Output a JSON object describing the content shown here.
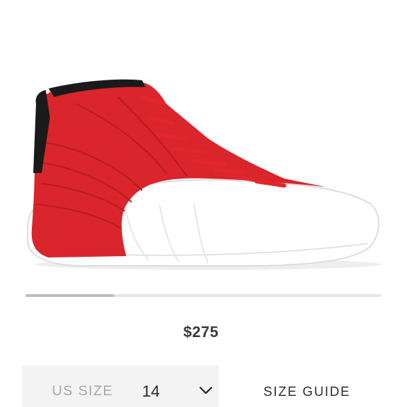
{
  "product": {
    "price": "$275",
    "image_alt": "Red and white high-top basketball sneaker",
    "colors": {
      "upper": "#d9252b",
      "sole": "#ffffff",
      "collar": "#1a1a1a"
    }
  },
  "carousel": {
    "progress": 0.25
  },
  "size_selector": {
    "label": "US SIZE",
    "value": "14",
    "icon": "chevron-down-icon"
  },
  "size_guide": {
    "label": "SIZE GUIDE"
  }
}
